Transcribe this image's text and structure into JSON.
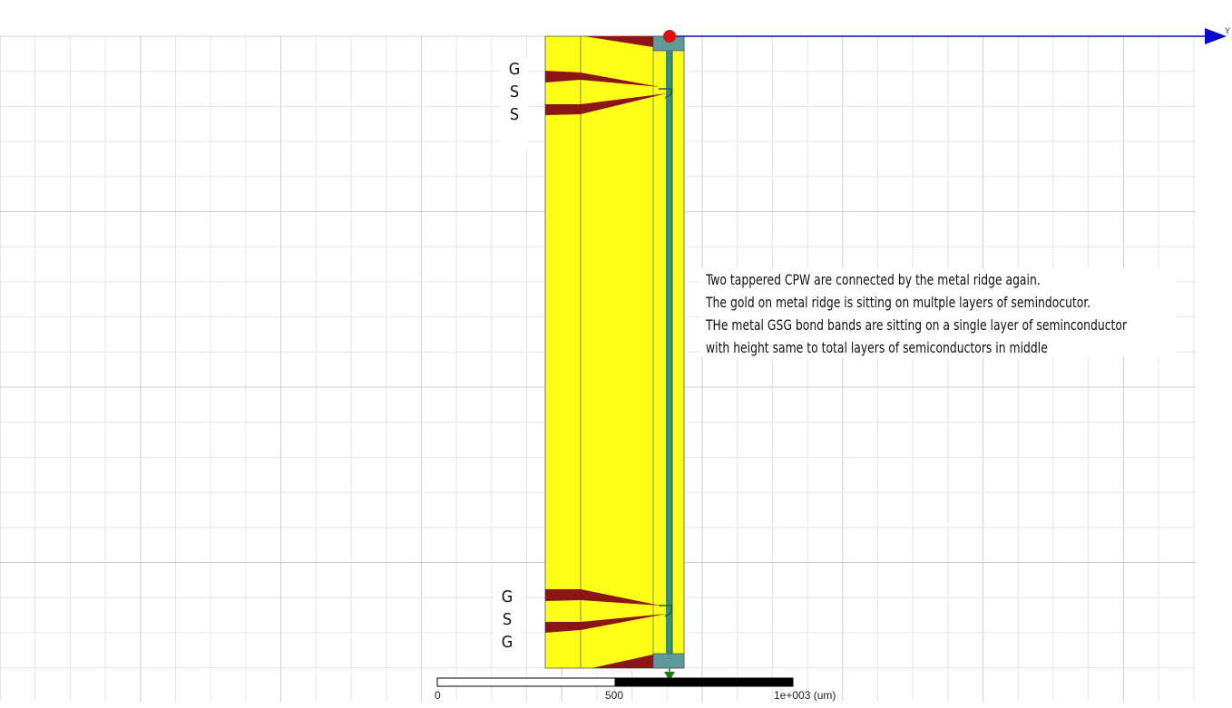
{
  "top_labels": [
    "G",
    "S",
    "S"
  ],
  "bottom_labels": [
    "G",
    "S",
    "G"
  ],
  "note": {
    "lines": [
      "Two tappered CPW are connected by the metal ridge again.",
      "The gold on metal ridge is sitting on multple layers of semindocutor.",
      "THe metal GSG bond bands are sitting on a single layer of seminconductor",
      "with height same to total layers of semiconductors in middle"
    ]
  },
  "axis": {
    "y_label": "Y"
  },
  "scale_bar": {
    "tick_labels": [
      "0",
      "500",
      "1e+003 (um)"
    ]
  },
  "colors": {
    "grid_minor": "#e6e6e6",
    "grid_major": "#cfcfcf",
    "substrate": "#ffff1a",
    "metal_pad": "#8b1414",
    "ridge": "#3c8c70",
    "ridge_cap": "#5f9a9a",
    "axis_blue": "#0a0ac8",
    "origin_red": "#e01010",
    "axis_green": "#1a7a1a"
  }
}
